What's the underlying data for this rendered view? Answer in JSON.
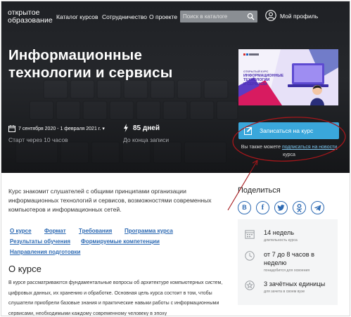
{
  "header": {
    "logo_line1": "открытое",
    "logo_line2": "образование",
    "nav": [
      "Каталог курсов",
      "Сотрудничество",
      "О проекте"
    ],
    "search_placeholder": "Поиск в каталоге",
    "profile_label": "Мой профиль"
  },
  "hero": {
    "title_line1": "Информационные",
    "title_line2": "технологии и сервисы",
    "dates": "7 сентября 2020 - 1 февраля 2021 г.  ▾",
    "start_in": "Старт через 10 часов",
    "days": "85 дней",
    "until": "До конца записи",
    "cover": {
      "kicker": "ОТКРЫТЫЙ КУРС",
      "title_line1": "ИНФОРМАЦИОННЫЕ",
      "title_line2": "ТЕХНОЛОГИИ",
      "title_line3": "И СЕРВИСЫ"
    },
    "enroll_label": "Записаться на курс",
    "also_prefix": "Вы также можете ",
    "also_link": "подписаться на новости",
    "also_suffix": "курса"
  },
  "intro_text": "Курс знакомит слушателей с общими принципами организации информационных технологий и сервисов, возможностями современных компьютеров и информационных сетей.",
  "share": {
    "title": "Поделиться",
    "icons": [
      "B",
      "f",
      "t",
      "ok",
      "tg"
    ],
    "colors": {
      "accent": "#2d6ab3"
    }
  },
  "tabs": [
    "О курсе",
    "Формат",
    "Требования",
    "Программа курса",
    "Результаты обучения",
    "Формируемые компетенции",
    "Направления подготовки"
  ],
  "about": {
    "title": "О курсе",
    "body": "В курсе рассматриваются фундаментальные вопросы об архитектуре компьютерных систем, цифровых данных, их хранению и обработке. Основная цель курса состоит в том, чтобы слушатели приобрели базовые знания и практические навыки работы с информационными сервисами, необходимыми каждому современному человеку в эпоху"
  },
  "info": [
    {
      "value": "14 недель",
      "note": "длительность курса",
      "icon": "calendar-icon"
    },
    {
      "value": "от 7 до 8 часов в неделю",
      "note": "понадобится для освоения",
      "icon": "clock-icon"
    },
    {
      "value": "3 зачётных единицы",
      "note": "для зачета в своем вузе",
      "icon": "star-badge-icon"
    }
  ],
  "colors": {
    "button": "#3aa7db",
    "link": "#2d6ab3",
    "annotation": "#a4171b"
  }
}
